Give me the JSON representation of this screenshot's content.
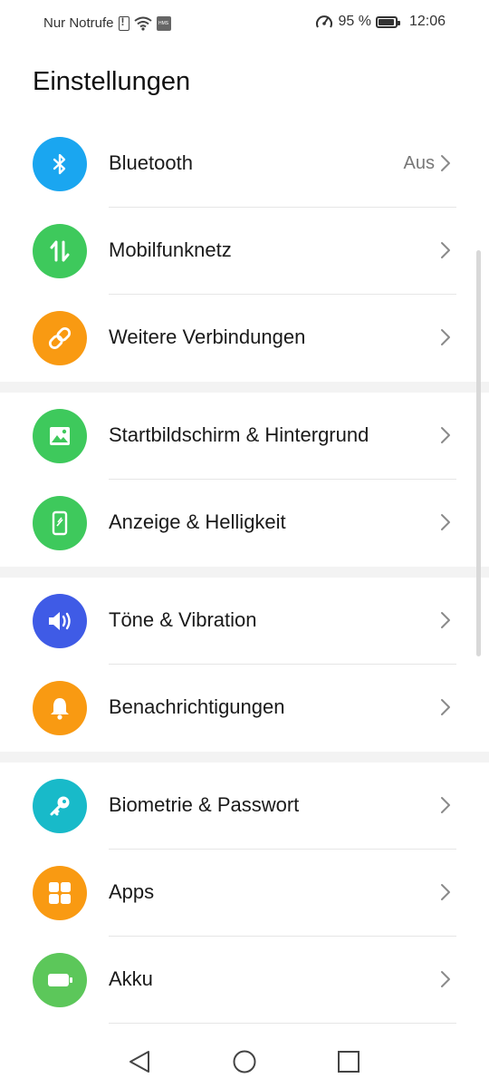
{
  "status": {
    "carrier": "Nur Notrufe",
    "battery_pct": "95 %",
    "time": "12:06",
    "icons": [
      "sim-alert-icon",
      "wifi-icon",
      "hms-icon",
      "performance-icon",
      "battery-icon"
    ]
  },
  "page_title": "Einstellungen",
  "groups": [
    [
      {
        "label": "Bluetooth",
        "value": "Aus",
        "icon": "bluetooth-icon",
        "color": "#1AA6F0"
      },
      {
        "label": "Mobilfunknetz",
        "value": "",
        "icon": "mobile-data-icon",
        "color": "#3EC95C"
      },
      {
        "label": "Weitere Verbindungen",
        "value": "",
        "icon": "link-icon",
        "color": "#F99A12"
      }
    ],
    [
      {
        "label": "Startbildschirm & Hintergrund",
        "value": "",
        "icon": "wallpaper-icon",
        "color": "#3EC95C"
      },
      {
        "label": "Anzeige & Helligkeit",
        "value": "",
        "icon": "display-icon",
        "color": "#3EC95C"
      }
    ],
    [
      {
        "label": "Töne & Vibration",
        "value": "",
        "icon": "sound-icon",
        "color": "#3F5BE6"
      },
      {
        "label": "Benachrichtigungen",
        "value": "",
        "icon": "bell-icon",
        "color": "#F99A12"
      }
    ],
    [
      {
        "label": "Biometrie & Passwort",
        "value": "",
        "icon": "key-icon",
        "color": "#18BAC9"
      },
      {
        "label": "Apps",
        "value": "",
        "icon": "apps-grid-icon",
        "color": "#F99A12"
      },
      {
        "label": "Akku",
        "value": "",
        "icon": "battery-icon",
        "color": "#5CC75A"
      }
    ]
  ],
  "navbar": {
    "icons": [
      "back-icon",
      "home-icon",
      "recents-icon"
    ]
  }
}
